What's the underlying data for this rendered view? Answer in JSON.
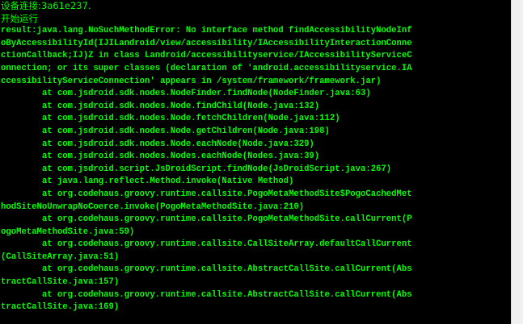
{
  "console": {
    "lines": [
      "设备连接:3a61e237.",
      "开始运行",
      "result:java.lang.NoSuchMethodError: No interface method findAccessibilityNodeInf",
      "oByAccessibilityId(IJILandroid/view/accessibility/IAccessibilityInteractionConne",
      "ctionCallback;IJ)Z in class Landroid/accessibilityservice/IAccessibilityServiceC",
      "onnection; or its super classes (declaration of 'android.accessibilityservice.IA",
      "ccessibilityServiceConnection' appears in /system/framework/framework.jar)",
      "        at com.jsdroid.sdk.nodes.NodeFinder.findNode(NodeFinder.java:63)",
      "        at com.jsdroid.sdk.nodes.Node.findChild(Node.java:132)",
      "        at com.jsdroid.sdk.nodes.Node.fetchChildren(Node.java:112)",
      "        at com.jsdroid.sdk.nodes.Node.getChildren(Node.java:198)",
      "        at com.jsdroid.sdk.nodes.Node.eachNode(Node.java:329)",
      "        at com.jsdroid.sdk.nodes.Nodes.eachNode(Nodes.java:39)",
      "        at com.jsdroid.script.JsDroidScript.findNode(JsDroidScript.java:267)",
      "        at java.lang.reflect.Method.invoke(Native Method)",
      "        at org.codehaus.groovy.runtime.callsite.PogoMetaMethodSite$PogoCachedMet",
      "hodSiteNoUnwrapNoCoerce.invoke(PogoMetaMethodSite.java:210)",
      "        at org.codehaus.groovy.runtime.callsite.PogoMetaMethodSite.callCurrent(P",
      "ogoMetaMethodSite.java:59)",
      "        at org.codehaus.groovy.runtime.callsite.CallSiteArray.defaultCallCurrent",
      "(CallSiteArray.java:51)",
      "        at org.codehaus.groovy.runtime.callsite.AbstractCallSite.callCurrent(Abs",
      "tractCallSite.java:157)",
      "        at org.codehaus.groovy.runtime.callsite.AbstractCallSite.callCurrent(Abs",
      "tractCallSite.java:169)"
    ]
  },
  "colors": {
    "background": "#000000",
    "text": "#00ff00",
    "scrollbar": "#f0f0f0"
  }
}
